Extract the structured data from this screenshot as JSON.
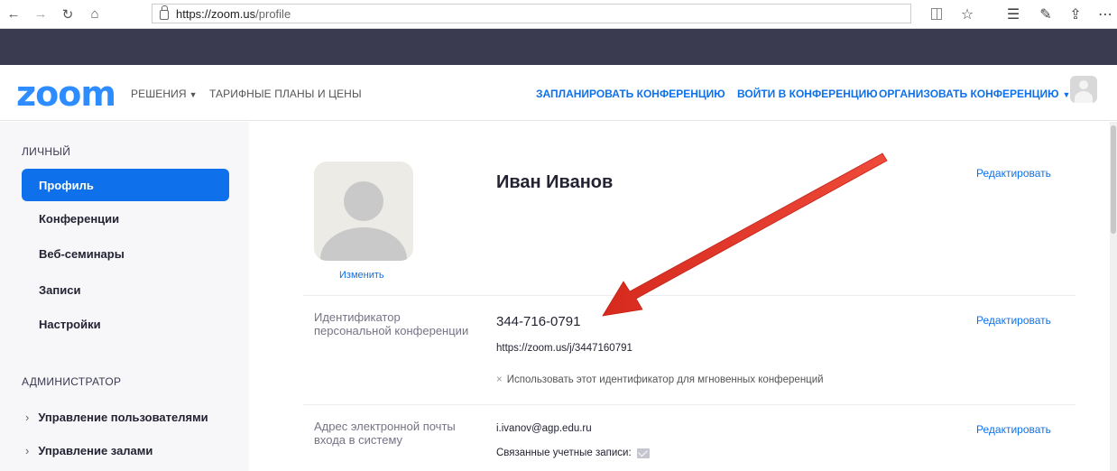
{
  "browser": {
    "url_host": "https://zoom.us",
    "url_path": "/profile"
  },
  "header": {
    "logo": "zoom",
    "nav_solutions": "РЕШЕНИЯ",
    "nav_plans": "ТАРИФНЫЕ ПЛАНЫ И ЦЕНЫ",
    "schedule": "ЗАПЛАНИРОВАТЬ КОНФЕРЕНЦИЮ",
    "join": "ВОЙТИ В КОНФЕРЕНЦИЮ",
    "host": "ОРГАНИЗОВАТЬ КОНФЕРЕНЦИЮ"
  },
  "sidebar": {
    "personal_heading": "ЛИЧНЫЙ",
    "items": [
      {
        "label": "Профиль",
        "active": true
      },
      {
        "label": "Конференции"
      },
      {
        "label": "Веб-семинары"
      },
      {
        "label": "Записи"
      },
      {
        "label": "Настройки"
      }
    ],
    "admin_heading": "АДМИНИСТРАТОР",
    "admin_items": [
      {
        "label": "Управление пользователями"
      },
      {
        "label": "Управление залами"
      }
    ]
  },
  "profile": {
    "change_photo": "Изменить",
    "name": "Иван Иванов",
    "edit": "Редактировать",
    "pmi_label": "Идентификатор персональной конференции",
    "pmi_value": "344-716-0791",
    "pmi_url": "https://zoom.us/j/3447160791",
    "pmi_option": "Использовать этот идентификатор для мгновенных конференций",
    "email_label": "Адрес электронной почты входа в систему",
    "email_value": "i.ivanov@agp.edu.ru",
    "linked_accounts": "Связанные учетные записи:"
  },
  "colors": {
    "accent": "#0e71eb",
    "logo": "#2d8cff",
    "arrow": "#e0392b"
  },
  "icons": [
    "back-icon",
    "forward-icon",
    "refresh-icon",
    "home-icon",
    "lock-icon",
    "reader-view-icon",
    "favorite-star-icon",
    "favorites-list-icon",
    "pen-icon",
    "share-icon",
    "more-icon",
    "mail-icon",
    "user-avatar-icon"
  ]
}
